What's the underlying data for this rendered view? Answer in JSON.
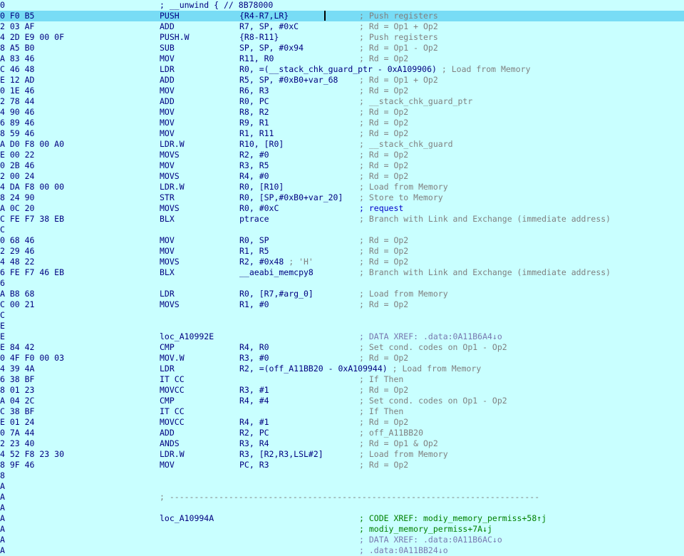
{
  "header": {
    "prefix": "0",
    "text": "; __unwind { // 8B78000"
  },
  "rows": [
    {
      "b": "0 F0 B5",
      "m": "PUSH",
      "o": "{R4-R7,LR}",
      "c": "; Push registers",
      "hl": true
    },
    {
      "b": "2 03 AF",
      "m": "ADD",
      "o": "R7, SP, #0xC",
      "c": "; Rd = Op1 + Op2"
    },
    {
      "b": "4 2D E9 00 0F",
      "m": "PUSH.W",
      "o": "{R8-R11}",
      "c": "; Push registers"
    },
    {
      "b": "8 A5 B0",
      "m": "SUB",
      "o": "SP, SP, #0x94",
      "c": "; Rd = Op1 - Op2"
    },
    {
      "b": "A 83 46",
      "m": "MOV",
      "o": "R11, R0",
      "c": "; Rd = Op2"
    },
    {
      "b": "C 46 48",
      "m": "LDR",
      "o": "R0, =(__stack_chk_guard_ptr - 0xA109906)",
      "ic": "; Load from Memory"
    },
    {
      "b": "E 12 AD",
      "m": "ADD",
      "o": "R5, SP, #0xB0+var_68",
      "c": "; Rd = Op1 + Op2"
    },
    {
      "b": "0 1E 46",
      "m": "MOV",
      "o": "R6, R3",
      "c": "; Rd = Op2"
    },
    {
      "b": "2 78 44",
      "m": "ADD",
      "o": "R0, PC",
      "c": "; __stack_chk_guard_ptr"
    },
    {
      "b": "4 90 46",
      "m": "MOV",
      "o": "R8, R2",
      "c": "; Rd = Op2"
    },
    {
      "b": "6 89 46",
      "m": "MOV",
      "o": "R9, R1",
      "c": "; Rd = Op2"
    },
    {
      "b": "8 59 46",
      "m": "MOV",
      "o": "R1, R11",
      "c": "; Rd = Op2"
    },
    {
      "b": "A D0 F8 00 A0",
      "m": "LDR.W",
      "o": "R10, [R0]",
      "c": "; __stack_chk_guard"
    },
    {
      "b": "E 00 22",
      "m": "MOVS",
      "o": "R2, #0",
      "c": "; Rd = Op2"
    },
    {
      "b": "0 2B 46",
      "m": "MOV",
      "o": "R3, R5",
      "c": "; Rd = Op2"
    },
    {
      "b": "2 00 24",
      "m": "MOVS",
      "o": "R4, #0",
      "c": "; Rd = Op2"
    },
    {
      "b": "4 DA F8 00 00",
      "m": "LDR.W",
      "o": "R0, [R10]",
      "c": "; Load from Memory"
    },
    {
      "b": "8 24 90",
      "m": "STR",
      "o": "R0, [SP,#0xB0+var_20]",
      "c": "; Store to Memory"
    },
    {
      "b": "A 0C 20",
      "m": "MOVS",
      "o": "R0, #0xC",
      "c": "; request",
      "cc": "blue"
    },
    {
      "b": "C FE F7 38 EB",
      "m": "BLX",
      "o": "ptrace",
      "c": "; Branch with Link and Exchange (immediate address)"
    },
    {
      "b": "C"
    },
    {
      "b": "0 68 46",
      "m": "MOV",
      "o": "R0, SP",
      "c": "; Rd = Op2"
    },
    {
      "b": "2 29 46",
      "m": "MOV",
      "o": "R1, R5",
      "c": "; Rd = Op2"
    },
    {
      "b": "4 48 22",
      "m": "MOVS",
      "o": "R2, #0x48",
      "ic": "; 'H'",
      "c": "; Rd = Op2"
    },
    {
      "b": "6 FE F7 46 EB",
      "m": "BLX",
      "o": "__aeabi_memcpy8",
      "c": "; Branch with Link and Exchange (immediate address)"
    },
    {
      "b": "6"
    },
    {
      "b": "A B8 68",
      "m": "LDR",
      "o": "R0, [R7,#arg_0]",
      "c": "; Load from Memory"
    },
    {
      "b": "C 00 21",
      "m": "MOVS",
      "o": "R1, #0",
      "c": "; Rd = Op2"
    },
    {
      "b": "C"
    },
    {
      "b": "E"
    },
    {
      "b": "E",
      "label": "loc_A10992E",
      "c": "; DATA XREF: .data:0A11B6A4↓o",
      "cc": "xref"
    },
    {
      "b": "E 84 42",
      "m": "CMP",
      "o": "R4, R0",
      "c": "; Set cond. codes on Op1 - Op2"
    },
    {
      "b": "0 4F F0 00 03",
      "m": "MOV.W",
      "o": "R3, #0",
      "c": "; Rd = Op2"
    },
    {
      "b": "4 39 4A",
      "m": "LDR",
      "o": "R2, =(off_A11BB20 - 0xA109944)",
      "ic": "; Load from Memory"
    },
    {
      "b": "6 38 BF",
      "m": "IT CC",
      "c": "; If Then"
    },
    {
      "b": "8 01 23",
      "m": "MOVCC",
      "o": "R3, #1",
      "c": "; Rd = Op2"
    },
    {
      "b": "A 04 2C",
      "m": "CMP",
      "o": "R4, #4",
      "c": "; Set cond. codes on Op1 - Op2"
    },
    {
      "b": "C 38 BF",
      "m": "IT CC",
      "c": "; If Then"
    },
    {
      "b": "E 01 24",
      "m": "MOVCC",
      "o": "R4, #1",
      "c": "; Rd = Op2"
    },
    {
      "b": "0 7A 44",
      "m": "ADD",
      "o": "R2, PC",
      "c": "; off_A11BB20"
    },
    {
      "b": "2 23 40",
      "m": "ANDS",
      "o": "R3, R4",
      "c": "; Rd = Op1 & Op2"
    },
    {
      "b": "4 52 F8 23 30",
      "m": "LDR.W",
      "o": "R3, [R2,R3,LSL#2]",
      "c": "; Load from Memory"
    },
    {
      "b": "8 9F 46",
      "m": "MOV",
      "o": "PC, R3",
      "c": "; Rd = Op2"
    },
    {
      "b": "8"
    },
    {
      "b": "A"
    },
    {
      "b": "A",
      "sep": "; ---------------------------------------------------------------------------"
    },
    {
      "b": "A"
    },
    {
      "b": "A",
      "label": "loc_A10994A",
      "c": "; CODE XREF: modiy_memory_permiss+58↑j",
      "cc": "green"
    },
    {
      "b": "A",
      "c": "; modiy_memory_permiss+7A↓j",
      "cc": "green"
    },
    {
      "b": "A",
      "c": "; DATA XREF: .data:0A11B6AC↓o",
      "cc": "xref"
    },
    {
      "b": "A",
      "c": "; .data:0A11BB24↓o",
      "cc": "xref"
    }
  ]
}
